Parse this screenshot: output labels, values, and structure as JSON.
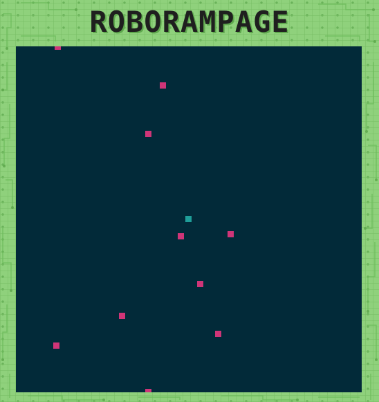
{
  "title": "ROBORAMPAGE",
  "colors": {
    "background": "#8fd17c",
    "arena": "#022a39",
    "player": "#1f9e99",
    "robot": "#cf3578",
    "title_text": "#1f1f1f"
  },
  "game": {
    "player_count": 1,
    "robot_count": 10
  }
}
